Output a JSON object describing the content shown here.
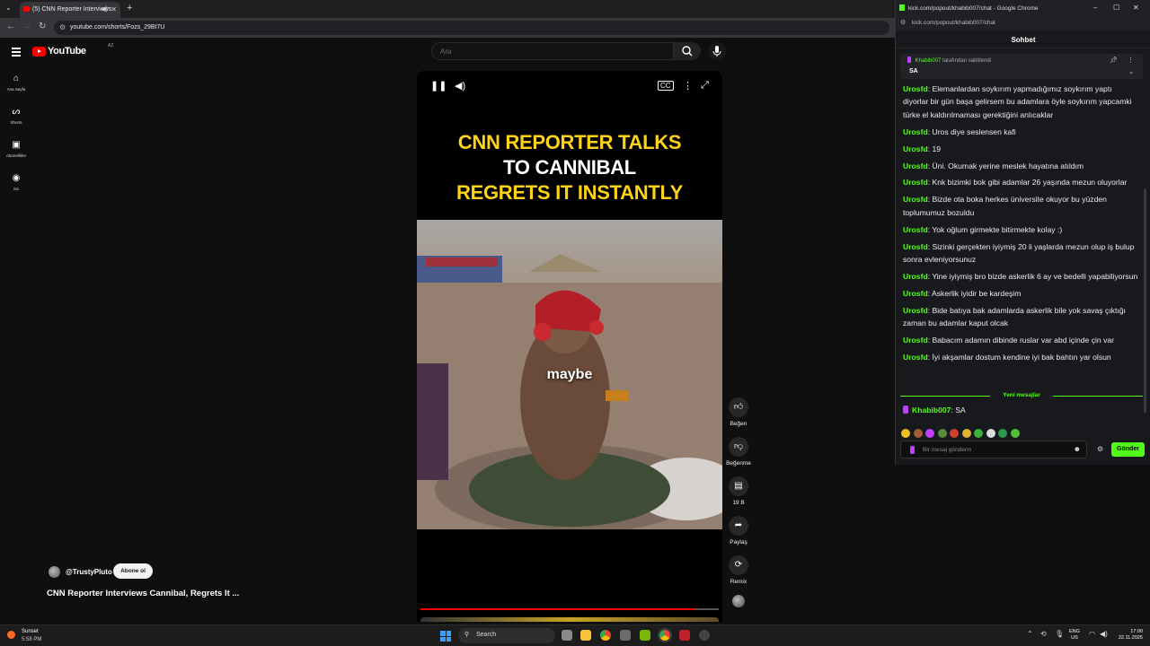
{
  "browser": {
    "tab_title": "(5) CNN Reporter Interviews",
    "url": "youtube.com/shorts/Fozs_29BI7U"
  },
  "youtube": {
    "logo_text": "YouTube",
    "logo_country": "AZ",
    "sidebar": [
      {
        "label": "Ana Sayfa",
        "icon": "home-icon"
      },
      {
        "label": "Shorts",
        "icon": "shorts-icon"
      },
      {
        "label": "Abonelikler",
        "icon": "subscriptions-icon"
      },
      {
        "label": "Siz",
        "icon": "user-icon"
      }
    ],
    "search_placeholder": "Ara",
    "video": {
      "headline_line1": "CNN REPORTER TALKS",
      "headline_line2": "TO CANNIBAL",
      "headline_line3": "REGRETS IT INSTANTLY",
      "subtitle": "maybe",
      "progress_fraction": 0.92
    },
    "actions": {
      "like": "Beğen",
      "dislike": "Beğenme",
      "comments": "19 B",
      "share": "Paylaş",
      "remix": "Remix"
    },
    "channel_name": "@TrustyPluto",
    "subscribe_label": "Abone ol",
    "video_title": "CNN Reporter Interviews Cannibal, Regrets It ..."
  },
  "kick": {
    "window_title": "kick.com/popout/khabib007/chat - Google Chrome",
    "url": "kick.com/popout/khabib007/chat",
    "header": "Sohbet",
    "pinned_user": "Khabib007",
    "pinned_suffix": "tarafından sabitlendi",
    "pinned_message": "SA",
    "messages": [
      {
        "user": "Urosfd",
        "text": "Elemanlardan soykırım yapmadığımız soykırım yaptı diyorlar bir gün başa gelirsem bu adamlara öyle soykırım yapcamki türke el kaldırılmaması gerektiğini anlıcaklar"
      },
      {
        "user": "Urosfd",
        "text": "Uros diye seslensen kafi"
      },
      {
        "user": "Urosfd",
        "text": "19"
      },
      {
        "user": "Urosfd",
        "text": "Üni. Okumak yerine meslek hayatına atıldım"
      },
      {
        "user": "Urosfd",
        "text": "Knk bizimki bok gibi adamlar 26 yaşında mezun oluyorlar"
      },
      {
        "user": "Urosfd",
        "text": "Bizde ota boka herkes üniversite okuyor bu yüzden toplumumuz bozuldu"
      },
      {
        "user": "Urosfd",
        "text": "Yok oğlum girmekte bitirmekte kolay :)"
      },
      {
        "user": "Urosfd",
        "text": "Sizinki gerçekten iyiymiş 20 li yaşlarda mezun olup iş bulup sonra evleniyorsunuz"
      },
      {
        "user": "Urosfd",
        "text": "Yine iyiymiş bro bizde askerlik 6 ay ve bedelli yapabiliyorsun"
      },
      {
        "user": "Urosfd",
        "text": "Askerlik iyidir be kardeşim"
      },
      {
        "user": "Urosfd",
        "text": "Bide batıya bak adamlarda askerlik bile yok savaş çıktığı zaman bu adamlar kaput olcak"
      },
      {
        "user": "Urosfd",
        "text": "Babacım adamın dibinde ruslar var abd içinde çin var"
      },
      {
        "user": "Urosfd",
        "text": "İyi akşamlar dostum kendine iyi bak bahtın yar olsun"
      }
    ],
    "new_messages_label": "Yeni mesajlar",
    "new_message": {
      "user": "Khabib007",
      "text": "SA"
    },
    "input_placeholder": "Bir mesaj gönderin",
    "send_label": "Gönder",
    "accent": "#53fc18"
  },
  "taskbar": {
    "weather_title": "Sunset",
    "weather_time": "5:58 PM",
    "search_label": "Search",
    "lang_top": "ENG",
    "lang_bottom": "US",
    "time": "17:00",
    "date": "22.11.2025"
  }
}
